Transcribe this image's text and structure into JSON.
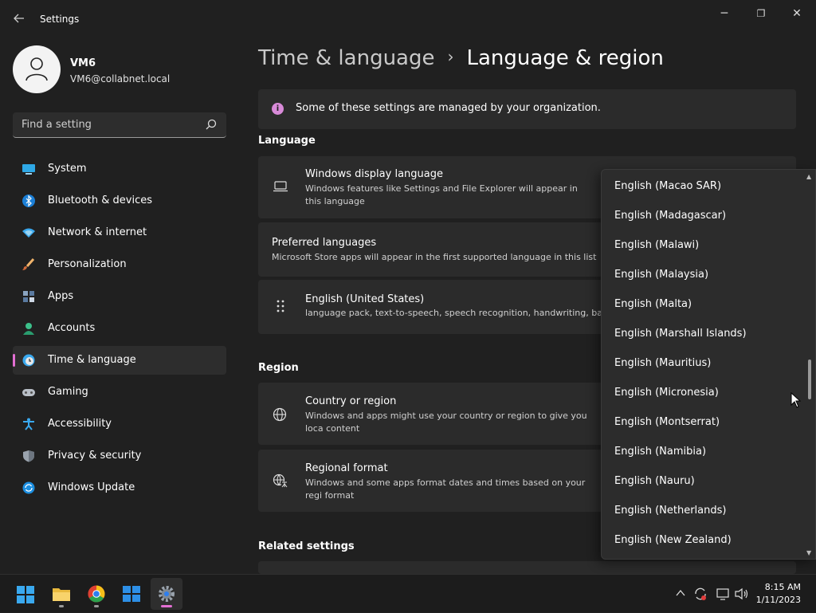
{
  "window": {
    "title": "Settings",
    "back_icon": "back-arrow-icon",
    "minimize": "─",
    "restore": "❐",
    "close": "✕"
  },
  "user": {
    "name": "VM6",
    "email": "VM6@collabnet.local"
  },
  "search": {
    "placeholder": "Find a setting"
  },
  "nav": {
    "items": [
      {
        "label": "System",
        "icon": "system-icon"
      },
      {
        "label": "Bluetooth & devices",
        "icon": "bluetooth-icon"
      },
      {
        "label": "Network & internet",
        "icon": "network-icon"
      },
      {
        "label": "Personalization",
        "icon": "brush-icon"
      },
      {
        "label": "Apps",
        "icon": "apps-icon"
      },
      {
        "label": "Accounts",
        "icon": "accounts-icon"
      },
      {
        "label": "Time & language",
        "icon": "clock-icon",
        "active": true
      },
      {
        "label": "Gaming",
        "icon": "gamepad-icon"
      },
      {
        "label": "Accessibility",
        "icon": "accessibility-icon"
      },
      {
        "label": "Privacy & security",
        "icon": "shield-icon"
      },
      {
        "label": "Windows Update",
        "icon": "update-icon"
      }
    ]
  },
  "breadcrumb": {
    "parent": "Time & language",
    "separator": "›",
    "current": "Language & region"
  },
  "banner": {
    "text": "Some of these settings are managed by your organization."
  },
  "language": {
    "heading": "Language",
    "display": {
      "title": "Windows display language",
      "subtitle": "Windows features like Settings and File Explorer will appear in this language"
    },
    "preferred": {
      "title": "Preferred languages",
      "subtitle": "Microsoft Store apps will appear in the first supported language in this list"
    },
    "english_us": {
      "title": "English (United States)",
      "subtitle": "language pack, text-to-speech, speech recognition, handwriting, bas"
    }
  },
  "region": {
    "heading": "Region",
    "country": {
      "title": "Country or region",
      "subtitle": "Windows and apps might use your country or region to give you loca content"
    },
    "format": {
      "title": "Regional format",
      "subtitle": "Windows and some apps format dates and times based on your regi format"
    }
  },
  "related": {
    "heading": "Related settings"
  },
  "dropdown": {
    "options": [
      "English (Macao SAR)",
      "English (Madagascar)",
      "English (Malawi)",
      "English (Malaysia)",
      "English (Malta)",
      "English (Marshall Islands)",
      "English (Mauritius)",
      "English (Micronesia)",
      "English (Montserrat)",
      "English (Namibia)",
      "English (Nauru)",
      "English (Netherlands)",
      "English (New Zealand)"
    ],
    "scroll_position": 0.5
  },
  "taskbar": {
    "apps": [
      "start-icon",
      "file-explorer-icon",
      "chrome-icon",
      "store-icon",
      "settings-icon"
    ],
    "tray": {
      "time": "8:15 AM",
      "date": "1/11/2023"
    }
  },
  "colors": {
    "accent": "#e36fd3",
    "background": "#202020",
    "card": "#2b2b2b"
  }
}
